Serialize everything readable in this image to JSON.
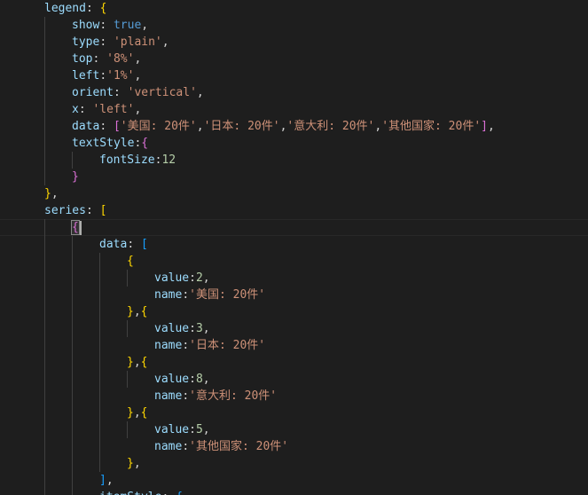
{
  "code": {
    "line1": {
      "key": "legend",
      "colon": ": ",
      "open": "{"
    },
    "line2": {
      "key": "show",
      "colon": ": ",
      "value": "true",
      "comma": ","
    },
    "line3": {
      "key": "type",
      "colon": ": ",
      "value": "'plain'",
      "comma": ","
    },
    "line4": {
      "key": "top",
      "colon": ": ",
      "value": "'8%'",
      "comma": ","
    },
    "line5": {
      "key": "left",
      "colon": ":",
      "value": "'1%'",
      "comma": ","
    },
    "line6": {
      "key": "orient",
      "colon": ": ",
      "value": "'vertical'",
      "comma": ","
    },
    "line7": {
      "key": "x",
      "colon": ": ",
      "value": "'left'",
      "comma": ","
    },
    "line8": {
      "key": "data",
      "colon": ": ",
      "open": "[",
      "items": [
        "'美国: 20件'",
        "'日本: 20件'",
        "'意大利: 20件'",
        "'其他国家: 20件'"
      ],
      "sep": ",",
      "close": "]",
      "comma": ","
    },
    "line9": {
      "key": "textStyle",
      "colon": ":",
      "open": "{"
    },
    "line10": {
      "key": "fontSize",
      "colon": ":",
      "value": "12"
    },
    "line11": {
      "close": "}"
    },
    "line12": {
      "close": "}",
      "comma": ","
    },
    "line13": {
      "key": "series",
      "colon": ": ",
      "open": "["
    },
    "line14": {
      "open": "{"
    },
    "line15": {
      "key": "data",
      "colon": ": ",
      "open": "["
    },
    "line16": {
      "open": "{"
    },
    "line17": {
      "key": "value",
      "colon": ":",
      "value": "2",
      "comma": ","
    },
    "line18": {
      "key": "name",
      "colon": ":",
      "value": "'美国: 20件'"
    },
    "line19": {
      "close": "}",
      "comma": ",",
      "open": "{"
    },
    "line20": {
      "key": "value",
      "colon": ":",
      "value": "3",
      "comma": ","
    },
    "line21": {
      "key": "name",
      "colon": ":",
      "value": "'日本: 20件'"
    },
    "line22": {
      "close": "}",
      "comma": ",",
      "open": "{"
    },
    "line23": {
      "key": "value",
      "colon": ":",
      "value": "8",
      "comma": ","
    },
    "line24": {
      "key": "name",
      "colon": ":",
      "value": "'意大利: 20件'"
    },
    "line25": {
      "close": "}",
      "comma": ",",
      "open": "{"
    },
    "line26": {
      "key": "value",
      "colon": ":",
      "value": "5",
      "comma": ","
    },
    "line27": {
      "key": "name",
      "colon": ":",
      "value": "'其他国家: 20件'"
    },
    "line28": {
      "close": "}",
      "comma": ","
    },
    "line29": {
      "close": "]",
      "comma": ","
    },
    "line30": {
      "key": "itemStyle",
      "colon": ": ",
      "open": "{"
    }
  },
  "colors": {
    "background": "#1e1e1e",
    "key": "#9cdcfe",
    "string": "#ce9178",
    "number": "#b5cea8",
    "keyword": "#569cd6",
    "bracket_level1": "#ffd700",
    "bracket_level2": "#da70d6",
    "bracket_level3": "#179fff"
  }
}
